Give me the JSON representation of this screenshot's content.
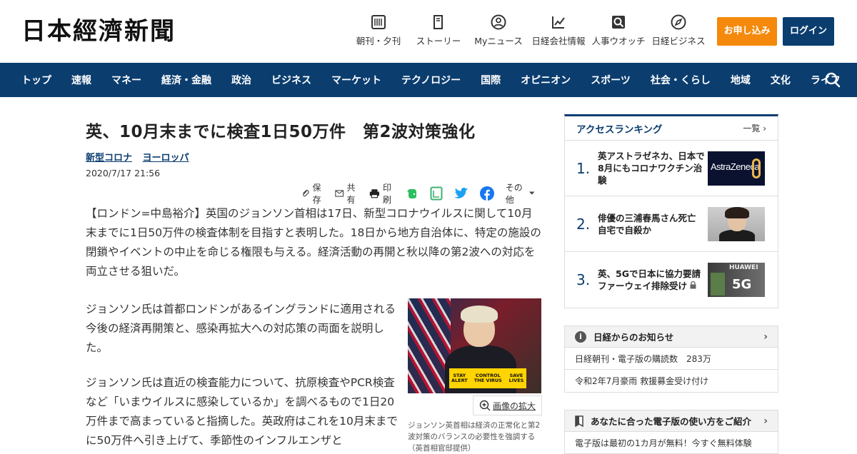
{
  "header": {
    "logo": "日本經濟新聞",
    "nav": [
      {
        "label": "朝刊・夕刊",
        "icon": "newspaper-icon"
      },
      {
        "label": "ストーリー",
        "icon": "book-icon"
      },
      {
        "label": "Myニュース",
        "icon": "user-icon"
      },
      {
        "label": "日経会社情報",
        "icon": "chart-icon"
      },
      {
        "label": "人事ウオッチ",
        "icon": "person-search-icon"
      },
      {
        "label": "日経ビジネス",
        "icon": "compass-icon"
      }
    ],
    "subscribe_label": "お申し込み",
    "login_label": "ログイン",
    "colors": {
      "brand": "#0b3d6f",
      "subscribe": "#f5890b"
    }
  },
  "mainnav": {
    "items": [
      "トップ",
      "速報",
      "マネー",
      "経済・金融",
      "政治",
      "ビジネス",
      "マーケット",
      "テクノロジー",
      "国際",
      "オピニオン",
      "スポーツ",
      "社会・くらし",
      "地域",
      "文化",
      "ライフ"
    ],
    "search_icon": "search-icon"
  },
  "article": {
    "title": "英、10月末までに検査1日50万件　第2波対策強化",
    "tags": [
      "新型コロナ",
      "ヨーロッパ"
    ],
    "date": "2020/7/17 21:56",
    "share": {
      "save": "保存",
      "share": "共有",
      "print": "印刷",
      "other": "その他"
    },
    "lead": "【ロンドン=中島裕介】英国のジョンソン首相は17日、新型コロナウイルスに関して10月末までに1日50万件の検査体制を目指すと表明した。18日から地方自治体に、特定の施設の閉鎖やイベントの中止を命じる権限も与える。経済活動の再開と秋以降の第2波への対応を両立させる狙いだ。",
    "para1": "ジョンソン氏は首都ロンドンがあるイングランドに適用される今後の経済再開策と、感染再拡大への対応策の両面を説明した。",
    "para2": "ジョンソン氏は直近の検査能力について、抗原検査やPCR検査など「いまウイルスに感染しているか」を調べるもので1日20万件まで高まっていると指摘した。英政府はこれを10月末までに50万件へ引き上げて、季節性のインフルエンザと",
    "figure": {
      "sign": [
        "STAY ALERT",
        "CONTROL THE VIRUS",
        "SAVE LIVES"
      ],
      "zoom_label": "画像の拡大",
      "caption": "ジョンソン英首相は経済の正常化と第2波対策のバランスの必要性を強調する（英首相官邸提供）"
    }
  },
  "sidebar": {
    "ranking": {
      "title": "アクセスランキング",
      "all_label": "一覧",
      "items": [
        {
          "num": "1.",
          "text": "英アストラゼネカ、日本で8月にもコロナワクチン治験",
          "thumb": "AstraZeneca"
        },
        {
          "num": "2.",
          "text": "俳優の三浦春馬さん死亡　自宅で自殺か",
          "thumb": ""
        },
        {
          "num": "3.",
          "text": "英、5Gで日本に協力要請　ファーウェイ排除受け",
          "thumb": "HUAWEI",
          "thumb2": "5G"
        }
      ]
    },
    "notice": {
      "title": "日経からのお知らせ",
      "items": [
        {
          "label": "日経朝刊・電子版の購読数",
          "value": "283万"
        },
        {
          "label": "令和2年7月豪雨 救援募金受け付け",
          "value": ""
        }
      ]
    },
    "guide": {
      "title": "あなたに合った電子版の使い方をご紹介",
      "item": "電子版は最初の1カ月が無料！今すぐ無料体験"
    }
  }
}
